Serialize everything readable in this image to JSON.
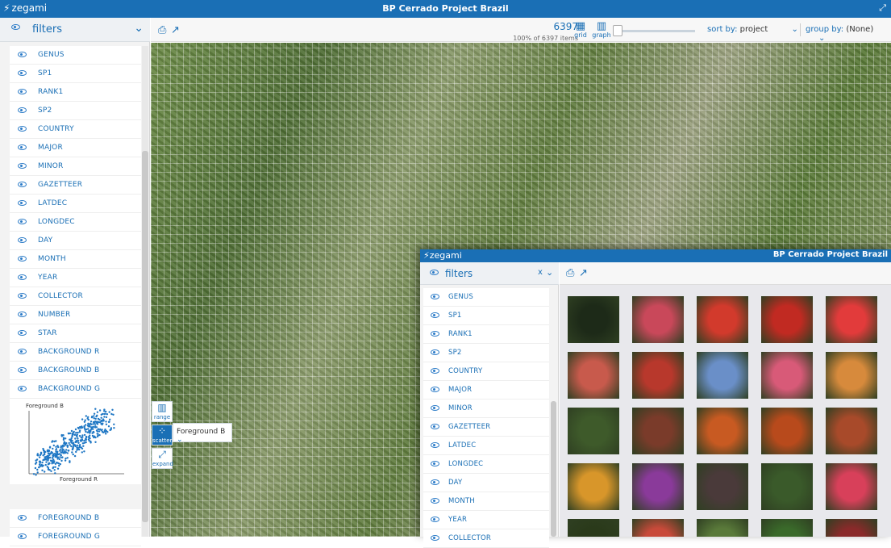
{
  "app": {
    "logo": "zegami",
    "title": "BP Cerrado Project Brazil"
  },
  "sidebar": {
    "header": "filters",
    "items": [
      "GENUS",
      "SP1",
      "RANK1",
      "SP2",
      "COUNTRY",
      "MAJOR",
      "MINOR",
      "GAZETTEER",
      "LATDEC",
      "LONGDEC",
      "DAY",
      "MONTH",
      "YEAR",
      "COLLECTOR",
      "NUMBER",
      "STAR",
      "BACKGROUND R",
      "BACKGROUND B",
      "BACKGROUND G",
      "FOREGROUND R"
    ],
    "items_after": [
      "FOREGROUND B",
      "FOREGROUND G"
    ]
  },
  "toolbar": {
    "count": "6397",
    "count_sub": "100% of 6397 items",
    "grid_label": "grid",
    "graph_label": "graph",
    "sort_label": "sort by:",
    "sort_value": "project",
    "group_label": "group by:",
    "group_value": "(None)"
  },
  "side_tools": {
    "range": "range",
    "scatter": "scatter",
    "expand": "expand",
    "axis_select": "Foreground B"
  },
  "chart_data": {
    "type": "scatter",
    "xlabel": "Foreground R",
    "ylabel": "Foreground B",
    "title": ""
  },
  "overlay": {
    "logo": "zegami",
    "title": "BP Cerrado Project Brazil",
    "header": "filters",
    "close": "x",
    "items": [
      "GENUS",
      "SP1",
      "RANK1",
      "SP2",
      "COUNTRY",
      "MAJOR",
      "MINOR",
      "GAZETTEER",
      "LATDEC",
      "LONGDEC",
      "DAY",
      "MONTH",
      "YEAR",
      "COLLECTOR"
    ],
    "thumb_colors": [
      [
        "#1d2a18",
        "#c9485a",
        "#d23a2c",
        "#c12a22",
        "#e23b3b"
      ],
      [
        "#c85a4c",
        "#b8382c",
        "#6a8fc8",
        "#d85a78",
        "#d78a3c"
      ],
      [
        "#3e5a2a",
        "#7a3b2a",
        "#c85a22",
        "#b84a1c",
        "#a84a2a"
      ],
      [
        "#d8962a",
        "#8a3a9a",
        "#4a3a3a",
        "#3a5a2a",
        "#d8405a"
      ],
      [
        "#2a3a1a",
        "#c84a3a",
        "#5a7a3a",
        "#3a6a2a",
        "#8a2a2a"
      ]
    ]
  }
}
